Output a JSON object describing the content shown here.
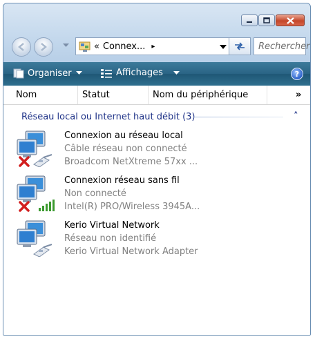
{
  "address": {
    "prefix": "«",
    "location": "Connex...",
    "arrow": "▸"
  },
  "search": {
    "placeholder": "Rechercher"
  },
  "toolbar": {
    "organise_label": "Organiser",
    "views_label": "Affichages",
    "help_label": "?"
  },
  "columns": [
    "Nom",
    "Statut",
    "Nom du périphérique",
    "»"
  ],
  "group": {
    "title": "Réseau local ou Internet haut débit (3)",
    "collapse_glyph": "˄"
  },
  "items": [
    {
      "name": "Connexion au réseau local",
      "status": "Câble réseau non connecté",
      "device": "Broadcom NetXtreme 57xx ...",
      "badge": "x-mark-icon",
      "adapter": "ethernet-icon"
    },
    {
      "name": "Connexion réseau sans fil",
      "status": "Non connecté",
      "device": "Intel(R) PRO/Wireless 3945A...",
      "badge": "x-mark-icon",
      "adapter": "signal-bars-icon"
    },
    {
      "name": "Kerio Virtual Network",
      "status": "Réseau non identifié",
      "device": "Kerio Virtual Network Adapter",
      "badge": "",
      "adapter": "ethernet-icon"
    }
  ],
  "colors": {
    "toolbar": "#2a6485",
    "group_text": "#1e3287",
    "secondary_text": "#808080",
    "close_button": "#c4472a",
    "error_red": "#d21f1f"
  }
}
